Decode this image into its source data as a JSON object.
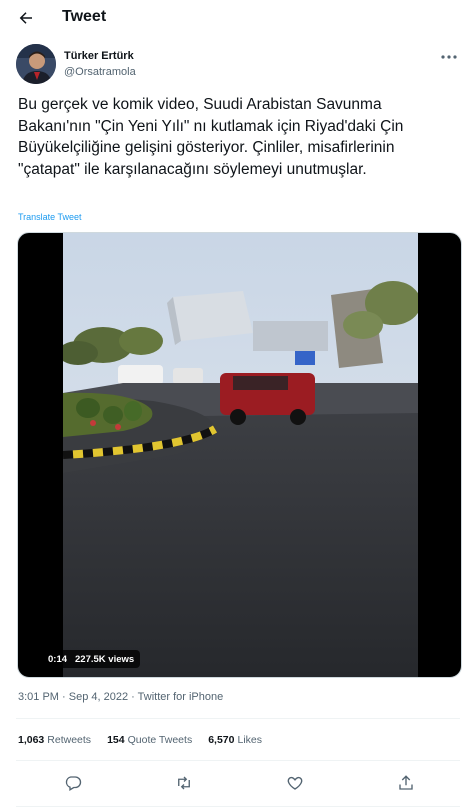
{
  "header": {
    "title": "Tweet"
  },
  "author": {
    "name": "Türker Ertürk",
    "handle": "@Orsatramola"
  },
  "tweet": {
    "text": "Bu gerçek ve komik video, Suudi Arabistan Savunma Bakanı'nın \"Çin Yeni Yılı\" nı kutlamak için Riyad'daki Çin Büyükelçiliğine gelişini gösteriyor. Çinliler, misafirlerinin \"çatapat\" ile karşılanacağını söylemeyi unutmuşlar.",
    "translate_label": "Translate Tweet",
    "timestamp": "3:01 PM · Sep 4, 2022 · Twitter for iPhone"
  },
  "video": {
    "duration": "0:14",
    "views": "227.5K views"
  },
  "stats": [
    {
      "count": "1,063",
      "label": "Retweets"
    },
    {
      "count": "154",
      "label": "Quote Tweets"
    },
    {
      "count": "6,570",
      "label": "Likes"
    }
  ],
  "icons": {
    "back": "back-arrow-icon",
    "more": "more-dots-icon",
    "reply": "reply-icon",
    "retweet": "retweet-icon",
    "like": "heart-icon",
    "share": "share-icon"
  },
  "colors": {
    "accent": "#1d9bf0",
    "secondary_text": "#536471",
    "divider": "#eff3f4"
  }
}
